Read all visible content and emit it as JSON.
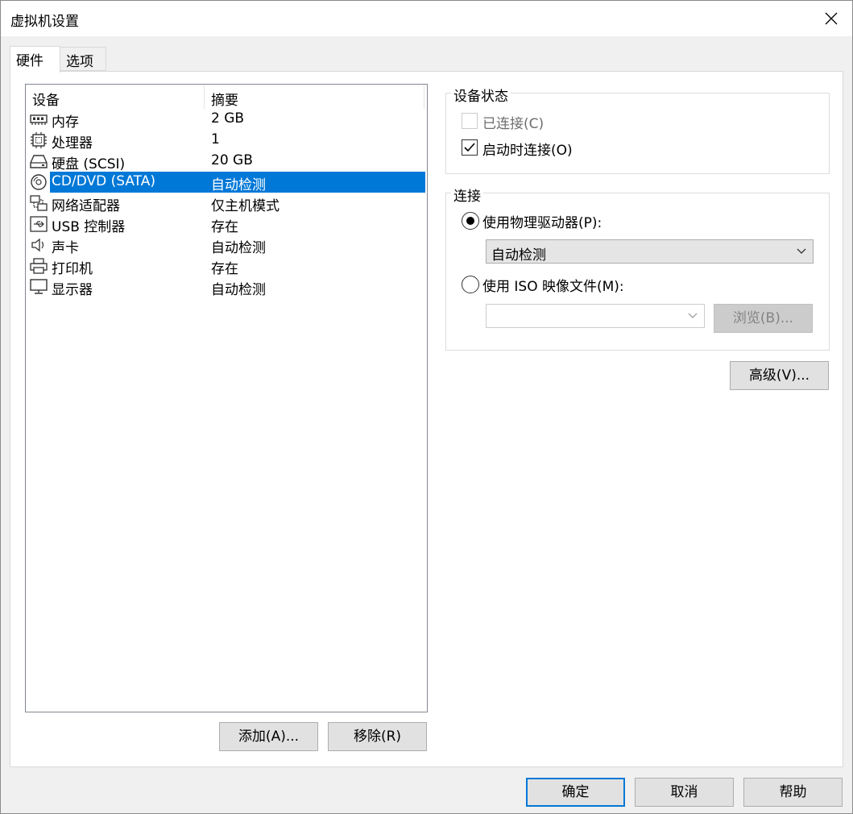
{
  "window": {
    "title": "虚拟机设置"
  },
  "tabs": [
    {
      "label": "硬件",
      "active": true
    },
    {
      "label": "选项",
      "active": false
    }
  ],
  "device_list": {
    "headers": {
      "device": "设备",
      "summary": "摘要"
    },
    "rows": [
      {
        "icon": "memory-icon",
        "name": "内存",
        "summary": "2 GB"
      },
      {
        "icon": "processor-icon",
        "name": "处理器",
        "summary": "1"
      },
      {
        "icon": "hard-disk-icon",
        "name": "硬盘 (SCSI)",
        "summary": "20 GB"
      },
      {
        "icon": "cd-dvd-icon",
        "name": "CD/DVD (SATA)",
        "summary": "自动检测",
        "selected": true
      },
      {
        "icon": "network-adapter-icon",
        "name": "网络适配器",
        "summary": "仅主机模式"
      },
      {
        "icon": "usb-icon",
        "name": "USB 控制器",
        "summary": "存在"
      },
      {
        "icon": "sound-card-icon",
        "name": "声卡",
        "summary": "自动检测"
      },
      {
        "icon": "printer-icon",
        "name": "打印机",
        "summary": "存在"
      },
      {
        "icon": "display-icon",
        "name": "显示器",
        "summary": "自动检测"
      }
    ]
  },
  "list_buttons": {
    "add": "添加(A)...",
    "remove": "移除(R)"
  },
  "device_status": {
    "title": "设备状态",
    "connected": {
      "label": "已连接(C)",
      "checked": false,
      "enabled": false
    },
    "connect_at_power_on": {
      "label": "启动时连接(O)",
      "checked": true,
      "enabled": true
    }
  },
  "connection": {
    "title": "连接",
    "physical_drive": {
      "label": "使用物理驱动器(P):",
      "selected": true,
      "value": "自动检测"
    },
    "iso_image": {
      "label": "使用 ISO 映像文件(M):",
      "selected": false,
      "value": "",
      "browse_label": "浏览(B)..."
    }
  },
  "advanced_button": "高级(V)...",
  "footer": {
    "ok": "确定",
    "cancel": "取消",
    "help": "帮助"
  }
}
